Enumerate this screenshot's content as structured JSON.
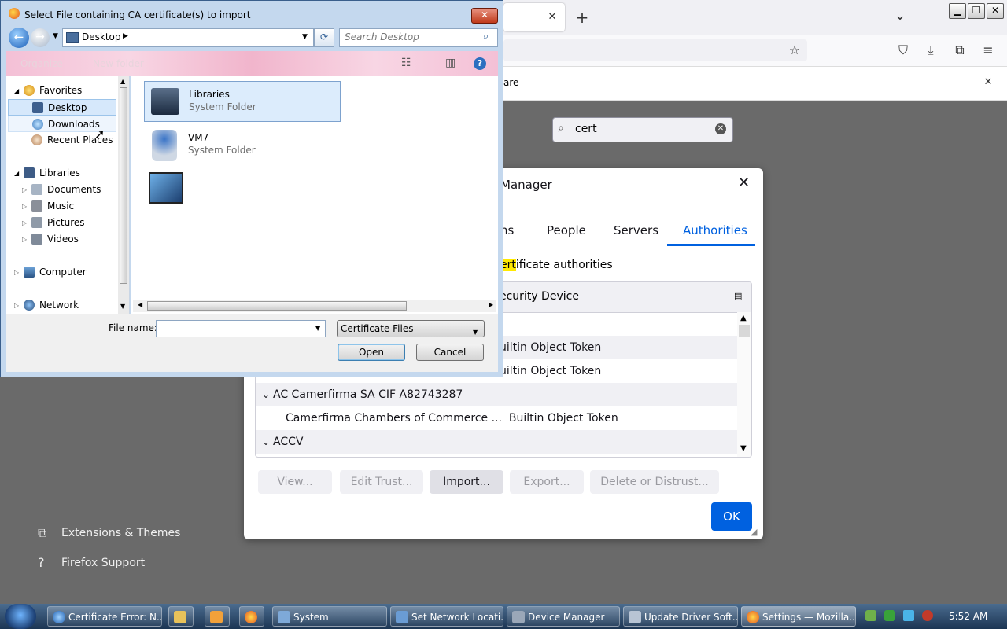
{
  "firefox": {
    "tabbar": {
      "close_glyph": "✕",
      "new_tab_glyph": "+",
      "list_tabs_glyph": "⌄"
    },
    "notification": {
      "text_fragment": "are"
    },
    "settings_search": {
      "value": "cert"
    },
    "side_links": [
      {
        "label": "Extensions & Themes"
      },
      {
        "label": "Firefox Support"
      }
    ]
  },
  "cert_manager": {
    "title": "Manager",
    "tabs": [
      {
        "label": "ns"
      },
      {
        "label": "People"
      },
      {
        "label": "Servers"
      },
      {
        "label": "Authorities"
      }
    ],
    "description_highlight": "ert",
    "description_rest": "ificate authorities",
    "column_header": "ecurity Device",
    "rows": [
      {
        "label": "uiltin Object Token"
      },
      {
        "label": "uiltin Object Token"
      },
      {
        "label": "AC Camerfirma SA CIF A82743287"
      },
      {
        "label": "Camerfirma Chambers of Commerce ...  Builtin Object Token"
      },
      {
        "label": "ACCV"
      }
    ],
    "buttons": {
      "view": "View...",
      "edit_trust": "Edit Trust...",
      "import": "Import...",
      "export": "Export...",
      "delete": "Delete or Distrust..."
    },
    "ok": "OK"
  },
  "file_dialog": {
    "title": "Select File containing CA certificate(s) to import",
    "path": "Desktop",
    "search_placeholder": "Search Desktop",
    "command_bar": {
      "organize": "Organize",
      "new_folder": "New folder"
    },
    "nav": {
      "favorites": "Favorites",
      "desktop": "Desktop",
      "downloads": "Downloads",
      "recent_places": "Recent Places",
      "libraries": "Libraries",
      "documents": "Documents",
      "music": "Music",
      "pictures": "Pictures",
      "videos": "Videos",
      "computer": "Computer",
      "network": "Network"
    },
    "files": [
      {
        "name": "Libraries",
        "type": "System Folder"
      },
      {
        "name": "VM7",
        "type": "System Folder"
      }
    ],
    "file_name_label": "File name:",
    "file_name_value": "",
    "file_type": "Certificate Files",
    "open": "Open",
    "cancel": "Cancel"
  },
  "taskbar": {
    "items": [
      {
        "label": "Certificate Error: N..."
      },
      {
        "label": "System"
      },
      {
        "label": "Set Network Locati..."
      },
      {
        "label": "Device Manager"
      },
      {
        "label": "Update Driver Soft..."
      },
      {
        "label": "Settings — Mozilla..."
      }
    ],
    "clock": "5:52 AM"
  },
  "colors": {
    "accent": "#0061e0",
    "highlight": "#ffe900",
    "taskbar": "#1c3553"
  }
}
